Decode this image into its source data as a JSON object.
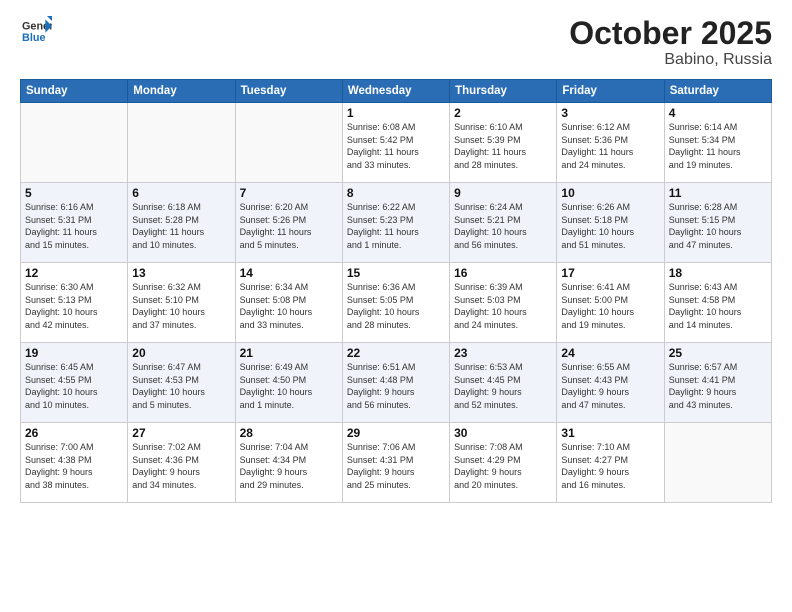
{
  "logo": {
    "general": "General",
    "blue": "Blue"
  },
  "title": {
    "month": "October 2025",
    "location": "Babino, Russia"
  },
  "headers": [
    "Sunday",
    "Monday",
    "Tuesday",
    "Wednesday",
    "Thursday",
    "Friday",
    "Saturday"
  ],
  "weeks": [
    [
      {
        "day": "",
        "info": ""
      },
      {
        "day": "",
        "info": ""
      },
      {
        "day": "",
        "info": ""
      },
      {
        "day": "1",
        "info": "Sunrise: 6:08 AM\nSunset: 5:42 PM\nDaylight: 11 hours\nand 33 minutes."
      },
      {
        "day": "2",
        "info": "Sunrise: 6:10 AM\nSunset: 5:39 PM\nDaylight: 11 hours\nand 28 minutes."
      },
      {
        "day": "3",
        "info": "Sunrise: 6:12 AM\nSunset: 5:36 PM\nDaylight: 11 hours\nand 24 minutes."
      },
      {
        "day": "4",
        "info": "Sunrise: 6:14 AM\nSunset: 5:34 PM\nDaylight: 11 hours\nand 19 minutes."
      }
    ],
    [
      {
        "day": "5",
        "info": "Sunrise: 6:16 AM\nSunset: 5:31 PM\nDaylight: 11 hours\nand 15 minutes."
      },
      {
        "day": "6",
        "info": "Sunrise: 6:18 AM\nSunset: 5:28 PM\nDaylight: 11 hours\nand 10 minutes."
      },
      {
        "day": "7",
        "info": "Sunrise: 6:20 AM\nSunset: 5:26 PM\nDaylight: 11 hours\nand 5 minutes."
      },
      {
        "day": "8",
        "info": "Sunrise: 6:22 AM\nSunset: 5:23 PM\nDaylight: 11 hours\nand 1 minute."
      },
      {
        "day": "9",
        "info": "Sunrise: 6:24 AM\nSunset: 5:21 PM\nDaylight: 10 hours\nand 56 minutes."
      },
      {
        "day": "10",
        "info": "Sunrise: 6:26 AM\nSunset: 5:18 PM\nDaylight: 10 hours\nand 51 minutes."
      },
      {
        "day": "11",
        "info": "Sunrise: 6:28 AM\nSunset: 5:15 PM\nDaylight: 10 hours\nand 47 minutes."
      }
    ],
    [
      {
        "day": "12",
        "info": "Sunrise: 6:30 AM\nSunset: 5:13 PM\nDaylight: 10 hours\nand 42 minutes."
      },
      {
        "day": "13",
        "info": "Sunrise: 6:32 AM\nSunset: 5:10 PM\nDaylight: 10 hours\nand 37 minutes."
      },
      {
        "day": "14",
        "info": "Sunrise: 6:34 AM\nSunset: 5:08 PM\nDaylight: 10 hours\nand 33 minutes."
      },
      {
        "day": "15",
        "info": "Sunrise: 6:36 AM\nSunset: 5:05 PM\nDaylight: 10 hours\nand 28 minutes."
      },
      {
        "day": "16",
        "info": "Sunrise: 6:39 AM\nSunset: 5:03 PM\nDaylight: 10 hours\nand 24 minutes."
      },
      {
        "day": "17",
        "info": "Sunrise: 6:41 AM\nSunset: 5:00 PM\nDaylight: 10 hours\nand 19 minutes."
      },
      {
        "day": "18",
        "info": "Sunrise: 6:43 AM\nSunset: 4:58 PM\nDaylight: 10 hours\nand 14 minutes."
      }
    ],
    [
      {
        "day": "19",
        "info": "Sunrise: 6:45 AM\nSunset: 4:55 PM\nDaylight: 10 hours\nand 10 minutes."
      },
      {
        "day": "20",
        "info": "Sunrise: 6:47 AM\nSunset: 4:53 PM\nDaylight: 10 hours\nand 5 minutes."
      },
      {
        "day": "21",
        "info": "Sunrise: 6:49 AM\nSunset: 4:50 PM\nDaylight: 10 hours\nand 1 minute."
      },
      {
        "day": "22",
        "info": "Sunrise: 6:51 AM\nSunset: 4:48 PM\nDaylight: 9 hours\nand 56 minutes."
      },
      {
        "day": "23",
        "info": "Sunrise: 6:53 AM\nSunset: 4:45 PM\nDaylight: 9 hours\nand 52 minutes."
      },
      {
        "day": "24",
        "info": "Sunrise: 6:55 AM\nSunset: 4:43 PM\nDaylight: 9 hours\nand 47 minutes."
      },
      {
        "day": "25",
        "info": "Sunrise: 6:57 AM\nSunset: 4:41 PM\nDaylight: 9 hours\nand 43 minutes."
      }
    ],
    [
      {
        "day": "26",
        "info": "Sunrise: 7:00 AM\nSunset: 4:38 PM\nDaylight: 9 hours\nand 38 minutes."
      },
      {
        "day": "27",
        "info": "Sunrise: 7:02 AM\nSunset: 4:36 PM\nDaylight: 9 hours\nand 34 minutes."
      },
      {
        "day": "28",
        "info": "Sunrise: 7:04 AM\nSunset: 4:34 PM\nDaylight: 9 hours\nand 29 minutes."
      },
      {
        "day": "29",
        "info": "Sunrise: 7:06 AM\nSunset: 4:31 PM\nDaylight: 9 hours\nand 25 minutes."
      },
      {
        "day": "30",
        "info": "Sunrise: 7:08 AM\nSunset: 4:29 PM\nDaylight: 9 hours\nand 20 minutes."
      },
      {
        "day": "31",
        "info": "Sunrise: 7:10 AM\nSunset: 4:27 PM\nDaylight: 9 hours\nand 16 minutes."
      },
      {
        "day": "",
        "info": ""
      }
    ]
  ]
}
